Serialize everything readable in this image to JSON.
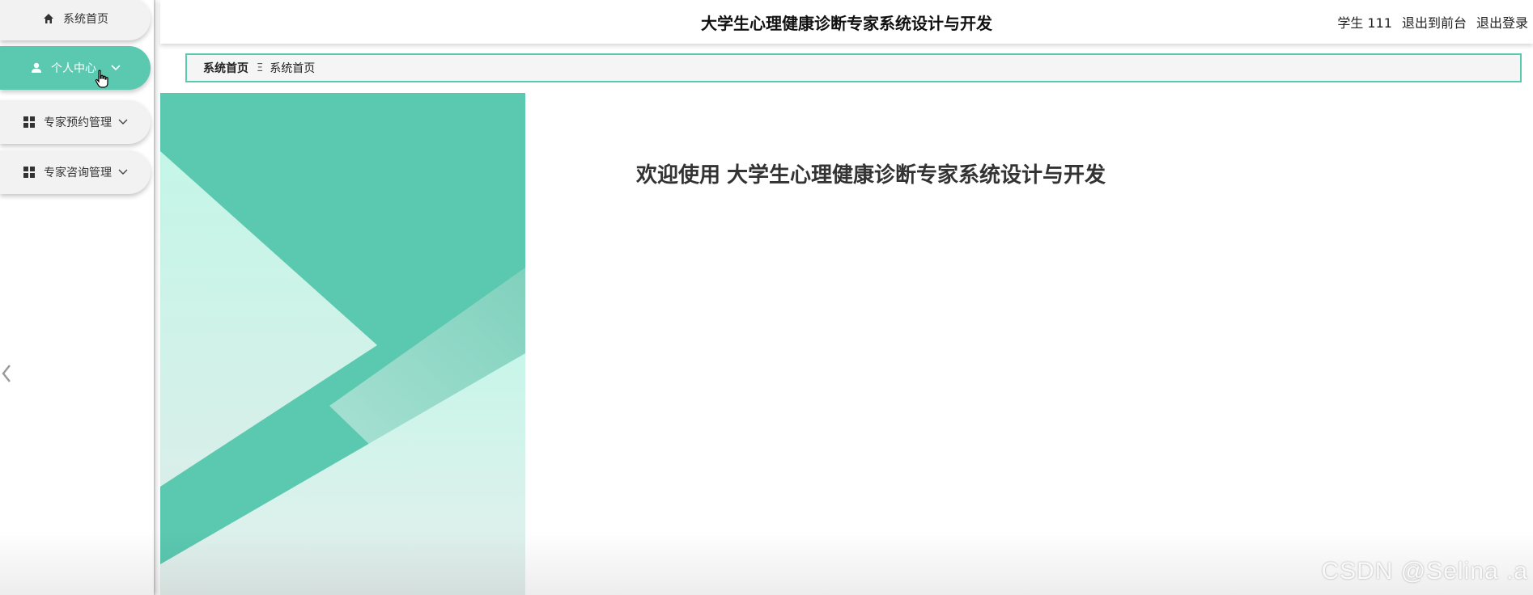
{
  "header": {
    "title": "大学生心理健康诊断专家系统设计与开发",
    "user_label": "学生 111",
    "to_front_label": "退出到前台",
    "logout_label": "退出登录"
  },
  "sidebar": {
    "items": [
      {
        "label": "系统首页",
        "icon": "home-icon"
      },
      {
        "label": "个人中心",
        "icon": "user-icon",
        "active": true
      },
      {
        "label": "专家预约管理",
        "icon": "grid-icon"
      },
      {
        "label": "专家咨询管理",
        "icon": "grid-icon"
      }
    ]
  },
  "breadcrumb": {
    "home": "系统首页",
    "separator": "Ξ",
    "current": "系统首页"
  },
  "welcome": {
    "prefix": "欢迎使用",
    "system_name": "大学生心理健康诊断专家系统设计与开发"
  },
  "watermark": "CSDN @Selina .a",
  "colors": {
    "accent": "#5bc8b0",
    "accent_dark": "#4fbfa6",
    "panel_light": "#c6f5e8"
  }
}
